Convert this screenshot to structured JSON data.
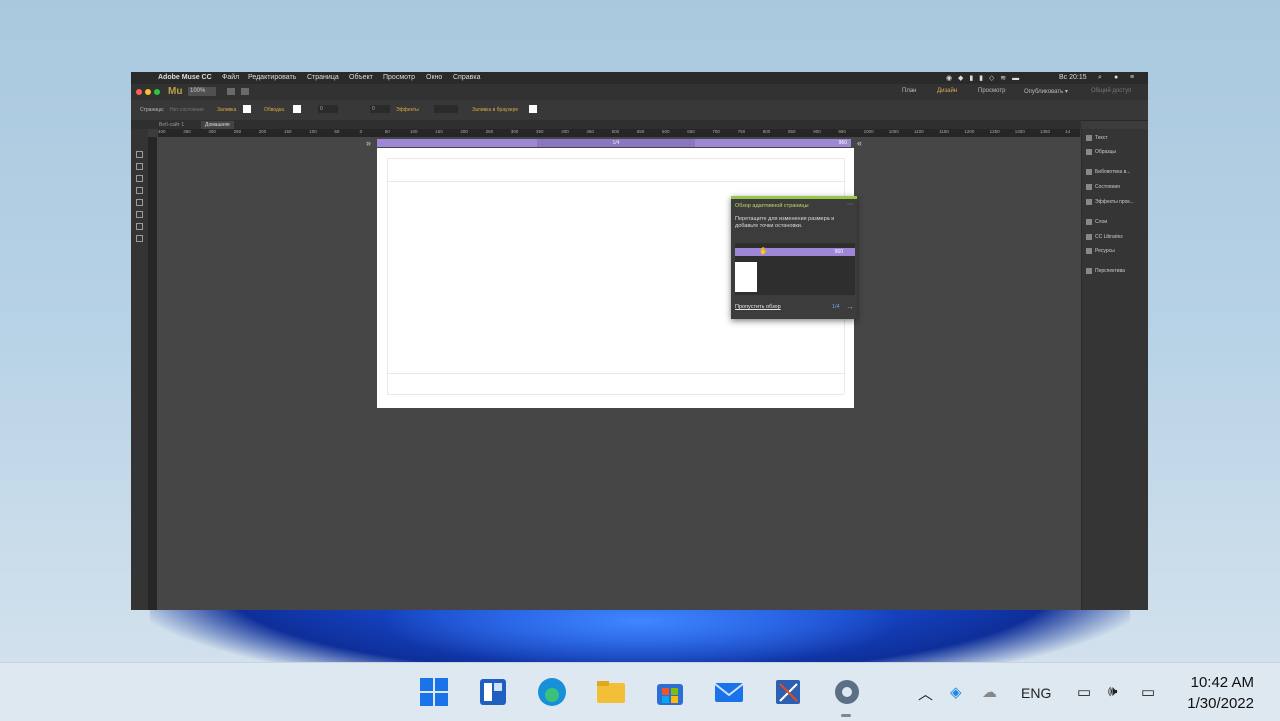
{
  "mac_menu": {
    "app_name": "Adobe Muse CC",
    "items": [
      "Файл",
      "Редактировать",
      "Страница",
      "Объект",
      "Просмотр",
      "Окно",
      "Справка"
    ],
    "clock": "Вс 20:15"
  },
  "app_toolbar": {
    "logo": "Mu",
    "zoom": "100%",
    "modes": [
      "План",
      "Дизайн",
      "Просмотр",
      "Опубликовать ▾",
      "Общий доступ"
    ]
  },
  "control_bar": {
    "page_label": "Страница:",
    "page_value": "Нет состояния",
    "fill_label": "Заливка",
    "stroke_label": "Обводка",
    "stroke_value": "0",
    "effects_label": "Эффекты",
    "browser_fill_label": "Заливка в браузере"
  },
  "doc_tabs": [
    "Веб-сайт 1",
    "Домашняя"
  ],
  "ruler_ticks": [
    "400",
    "350",
    "300",
    "250",
    "200",
    "150",
    "100",
    "50",
    "0",
    "50",
    "100",
    "150",
    "200",
    "250",
    "300",
    "350",
    "400",
    "450",
    "500",
    "550",
    "600",
    "650",
    "700",
    "750",
    "800",
    "850",
    "900",
    "950",
    "1000",
    "1050",
    "1100",
    "1150",
    "1200",
    "1250",
    "1300",
    "1350",
    "14"
  ],
  "breakpoint": {
    "center_label": "1/4",
    "width_label": "960"
  },
  "tour_popup": {
    "title": "Обзор адаптивной страницы",
    "description": "Перетащите для изменения размера и добавьте точки остановки.",
    "skip_link": "Пропустить обзор",
    "page_counter": "1/4",
    "preview_value": "960"
  },
  "right_panel": {
    "items": [
      "Текст",
      "Образцы",
      "Библиотека в...",
      "Состояния",
      "Эффекты прок...",
      "Слои",
      "CC Libraries",
      "Ресурсы",
      "Перспектива"
    ]
  },
  "taskbar": {
    "lang": "ENG",
    "time": "10:42 AM",
    "date": "1/30/2022"
  },
  "colors": {
    "breakpoint_bar": "#9e88d6",
    "tour_accent": "#9ac34a",
    "app_bg": "#3c3c3c"
  }
}
